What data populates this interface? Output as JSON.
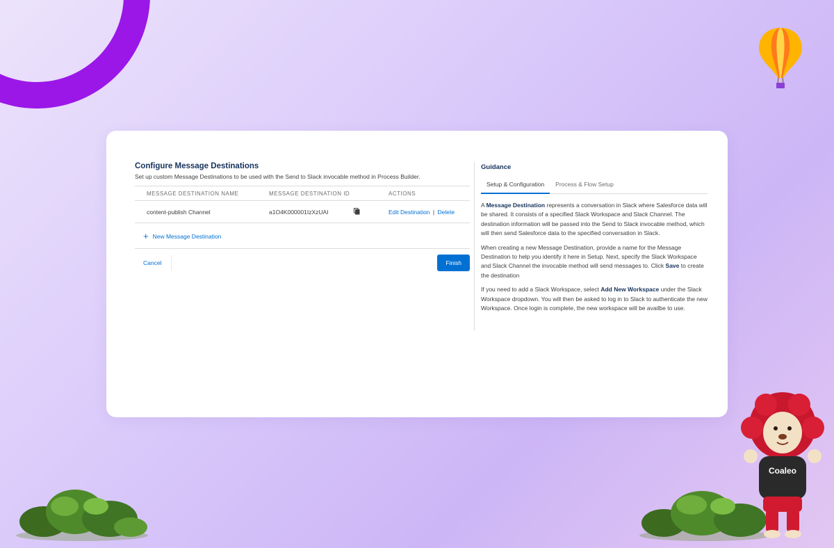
{
  "config": {
    "title": "Configure Message Destinations",
    "subtitle": "Set up custom Message Destinations to be used with the Send to Slack invocable method in Process Builder.",
    "columns": [
      "MESSAGE DESTINATION NAME",
      "MESSAGE DESTINATION ID",
      "ACTIONS"
    ],
    "rows": [
      {
        "name": "content-publish Channel",
        "id": "a1O4K000001IzXzUAI",
        "edit": "Edit Destination",
        "separator": "|",
        "delete": "Delete"
      }
    ],
    "new_destination": "New Message Destination",
    "cancel": "Cancel",
    "finish": "Finish"
  },
  "guidance": {
    "title": "Guidance",
    "tabs": [
      "Setup & Configuration",
      "Process & Flow Setup"
    ],
    "active_tab": "Setup & Configuration",
    "p1": {
      "a": "A ",
      "b": "Message Destination",
      "c": " represents a conversation in Slack where Salesforce data will be shared. It consists of a specified Slack Workspace and Slack Channel. The destination information will be passed into the Send to Slack invocable method, which will then send Salesforce data to the specified conversation in Slack."
    },
    "p2": {
      "a": "When creating a new Message Destination, provide a name for the Message Destination to help you identify it here in Setup. Next, specify the Slack Workspace and Slack Channel the invocable method will send messages to. Click ",
      "b": "Save",
      "c": " to create the destination"
    },
    "p3": {
      "a": "If you need to add a Slack Workspace, select ",
      "b": "Add New Workspace",
      "c": " under the Slack Workspace dropdown. You will then be asked to log in to Slack to authenticate the new Workspace. Once login is complete, the new workspace will be availbe to use."
    }
  },
  "mascot": {
    "shirt_text": "Coaleo"
  },
  "colors": {
    "accent": "#0070d2",
    "title": "#16325c",
    "ring": "#9a17e8"
  }
}
